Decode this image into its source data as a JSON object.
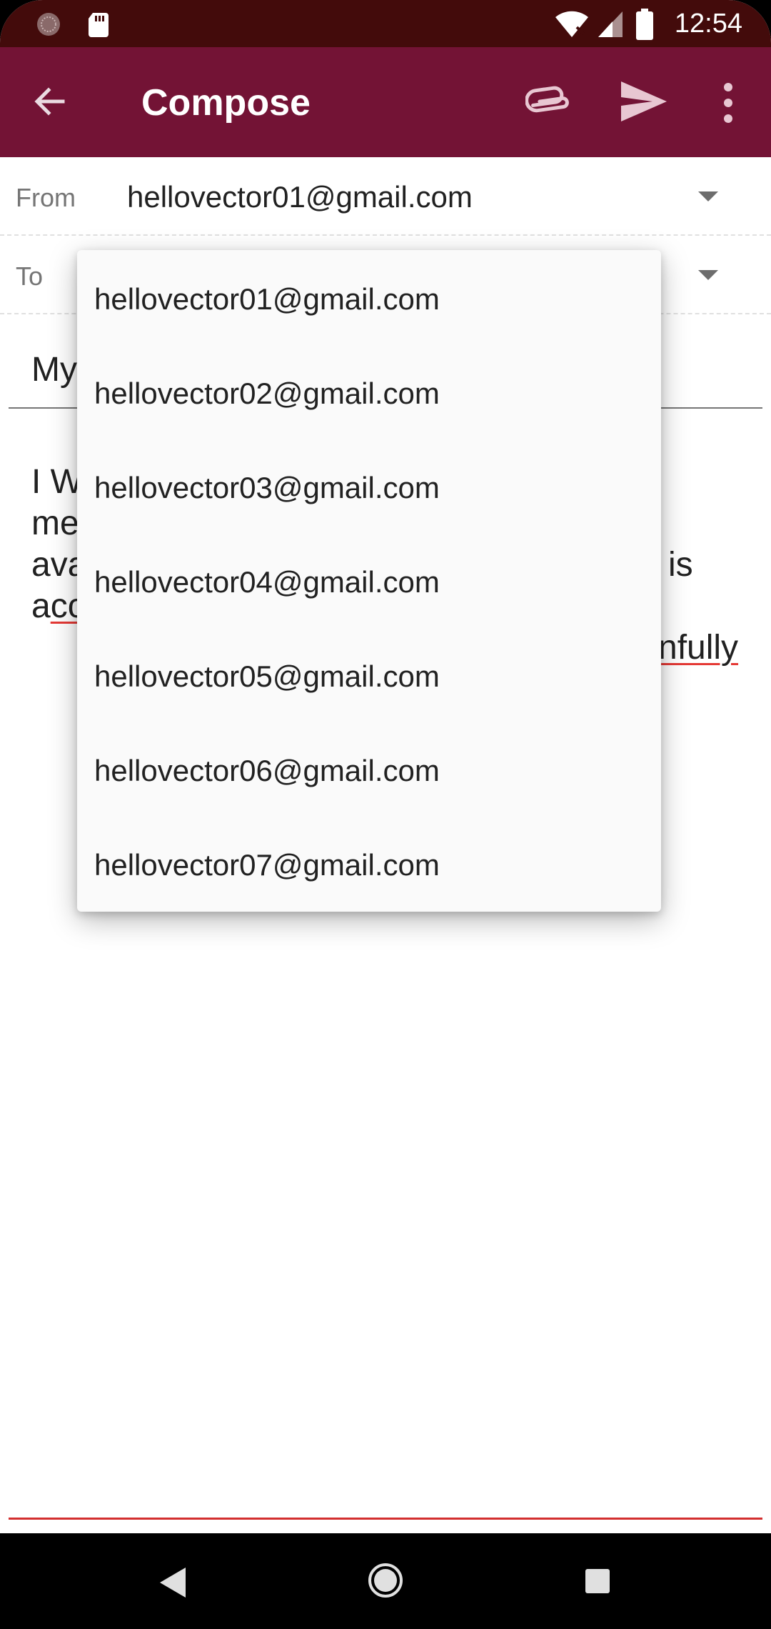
{
  "status_bar": {
    "time": "12:54",
    "icons": [
      "settings-icon",
      "sd-card-icon",
      "wifi-icon",
      "signal-icon",
      "battery-icon"
    ]
  },
  "app_bar": {
    "title": "Compose",
    "background": "#731335",
    "icons": [
      "back-arrow-icon",
      "attach-icon",
      "send-icon",
      "more-vert-icon"
    ]
  },
  "form": {
    "from_label": "From",
    "from_value": "hellovector01@gmail.com",
    "to_label": "To",
    "subject_visible": "My",
    "body_lines": [
      {
        "left": "I W",
        "right": ""
      },
      {
        "left": "me",
        "right": ""
      },
      {
        "left": "ava",
        "right": "is"
      },
      {
        "left": "a",
        "spell": "cc",
        "right": ""
      },
      {
        "left": "",
        "right_spell": "nfully"
      }
    ]
  },
  "dropdown": {
    "options": [
      "hellovector01@gmail.com",
      "hellovector02@gmail.com",
      "hellovector03@gmail.com",
      "hellovector04@gmail.com",
      "hellovector05@gmail.com",
      "hellovector06@gmail.com",
      "hellovector07@gmail.com"
    ]
  },
  "nav_bar": {
    "icons": [
      "back-triangle-icon",
      "home-circle-icon",
      "recents-square-icon"
    ]
  }
}
